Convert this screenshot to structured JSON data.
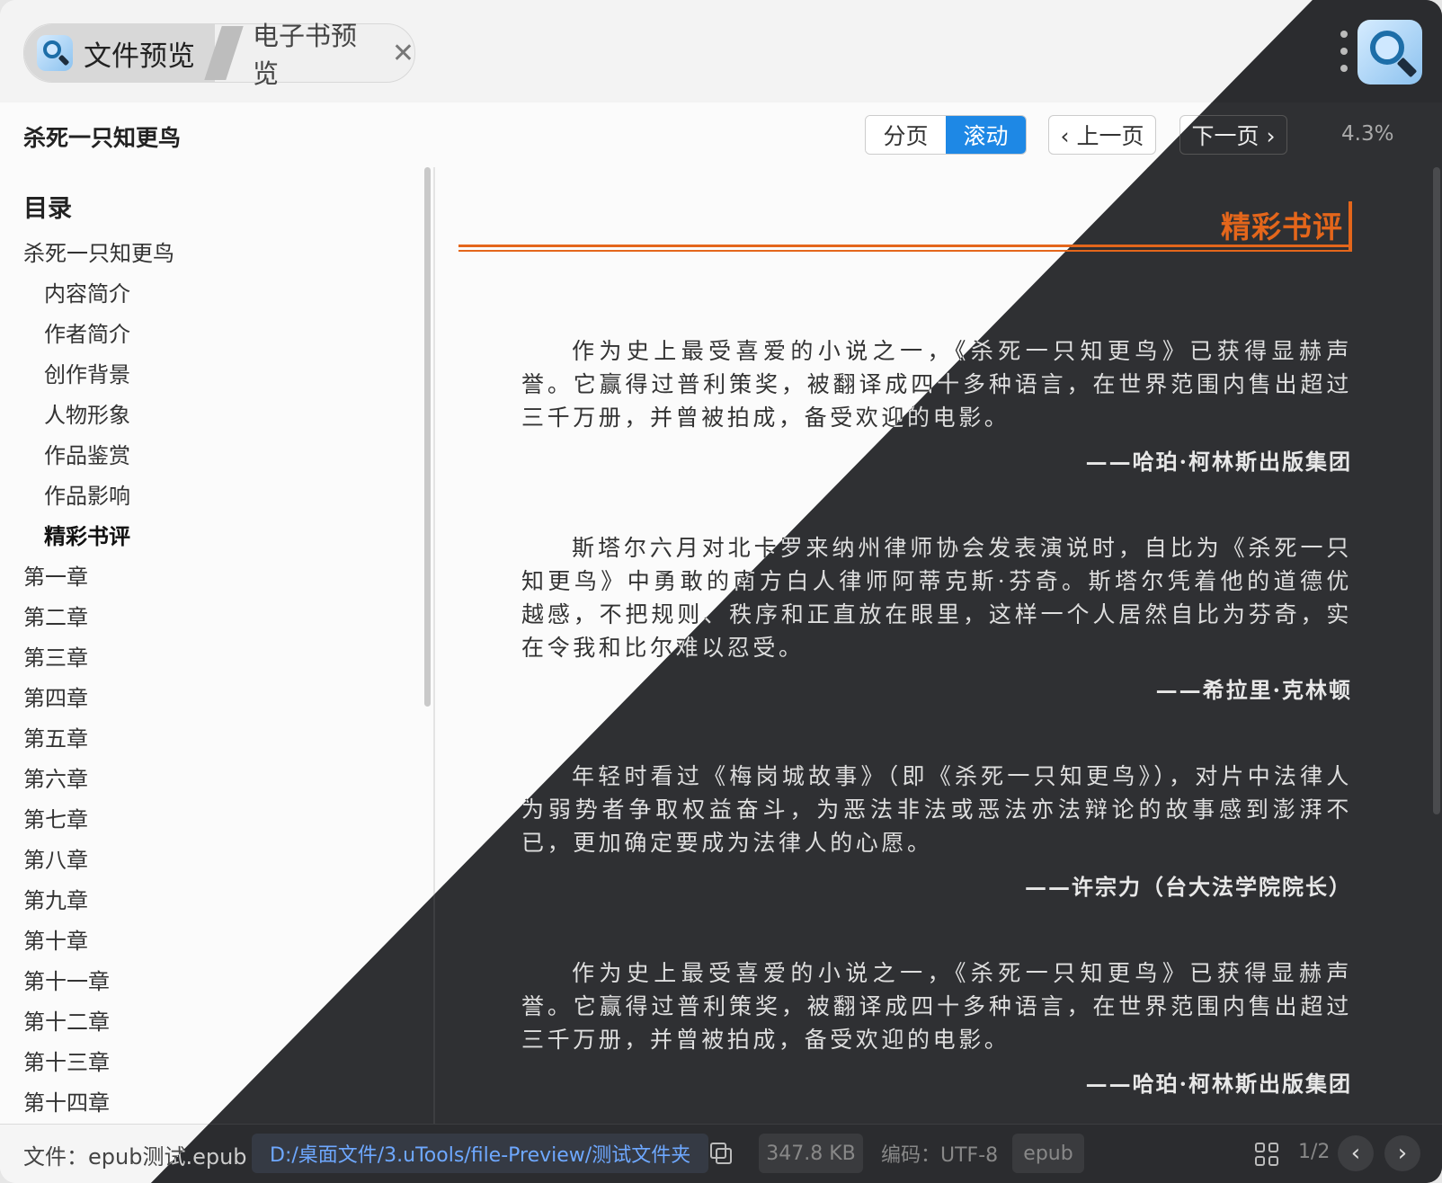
{
  "tabs": {
    "active_label": "文件预览",
    "second_label": "电子书预览",
    "close_icon": "close-icon",
    "app_icon": "magnifier-icon"
  },
  "toolbar": {
    "book_title": "杀死一只知更鸟",
    "mode_paged": "分页",
    "mode_scroll": "滚动",
    "active_mode": "滚动",
    "prev_page": "‹ 上一页",
    "next_page": "下一页 ›",
    "progress": "4.3%"
  },
  "toc": {
    "heading": "目录",
    "items": [
      {
        "label": "杀死一只知更鸟",
        "level": 0
      },
      {
        "label": "内容简介",
        "level": 1
      },
      {
        "label": "作者简介",
        "level": 1
      },
      {
        "label": "创作背景",
        "level": 1
      },
      {
        "label": "人物形象",
        "level": 1
      },
      {
        "label": "作品鉴赏",
        "level": 1
      },
      {
        "label": "作品影响",
        "level": 1
      },
      {
        "label": "精彩书评",
        "level": 1,
        "active": true
      },
      {
        "label": "第一章",
        "level": 0
      },
      {
        "label": "第二章",
        "level": 0
      },
      {
        "label": "第三章",
        "level": 0
      },
      {
        "label": "第四章",
        "level": 0
      },
      {
        "label": "第五章",
        "level": 0
      },
      {
        "label": "第六章",
        "level": 0
      },
      {
        "label": "第七章",
        "level": 0
      },
      {
        "label": "第八章",
        "level": 0
      },
      {
        "label": "第九章",
        "level": 0
      },
      {
        "label": "第十章",
        "level": 0
      },
      {
        "label": "第十一章",
        "level": 0
      },
      {
        "label": "第十二章",
        "level": 0
      },
      {
        "label": "第十三章",
        "level": 0
      },
      {
        "label": "第十四章",
        "level": 0
      }
    ]
  },
  "content": {
    "heading": "精彩书评",
    "blocks": [
      {
        "text": "作为史上最受喜爱的小说之一，《杀死一只知更鸟》已获得显赫声誉。它赢得过普利策奖，被翻译成四十多种语言，在世界范围内售出超过三千万册，并曾被拍成，备受欢迎的电影。",
        "attribution": "——哈珀·柯林斯出版集团"
      },
      {
        "text": "斯塔尔六月对北卡罗来纳州律师协会发表演说时，自比为《杀死一只知更鸟》中勇敢的南方白人律师阿蒂克斯·芬奇。斯塔尔凭着他的道德优越感，不把规则、秩序和正直放在眼里，这样一个人居然自比为芬奇，实在令我和比尔难以忍受。",
        "attribution": "——希拉里·克林顿"
      },
      {
        "text": "年轻时看过《梅岗城故事》（即《杀死一只知更鸟》），对片中法律人为弱势者争取权益奋斗，为恶法非法或恶法亦法辩论的故事感到澎湃不已，更加确定要成为法律人的心愿。",
        "attribution": "——许宗力（台大法学院院长）"
      },
      {
        "text": "作为史上最受喜爱的小说之一，《杀死一只知更鸟》已获得显赫声誉。它赢得过普利策奖，被翻译成四十多种语言，在世界范围内售出超过三千万册，并曾被拍成，备受欢迎的电影。",
        "attribution": "——哈珀·柯林斯出版集团"
      }
    ]
  },
  "status": {
    "file_label": "文件：epub测试.epub",
    "path": "D:/桌面文件/3.uTools/file-Preview/测试文件夹",
    "copy_icon": "copy-icon",
    "size": "347.8 KB",
    "encoding": "编码：UTF-8",
    "type": "epub",
    "grid_icon": "grid-icon",
    "page": "1/2"
  },
  "colors": {
    "accent": "#1e88e5",
    "heading_orange": "#e4661b",
    "path_link": "#2a6fd8",
    "dark_bg": "#2f3033",
    "light_bg": "#fbfbfb"
  }
}
